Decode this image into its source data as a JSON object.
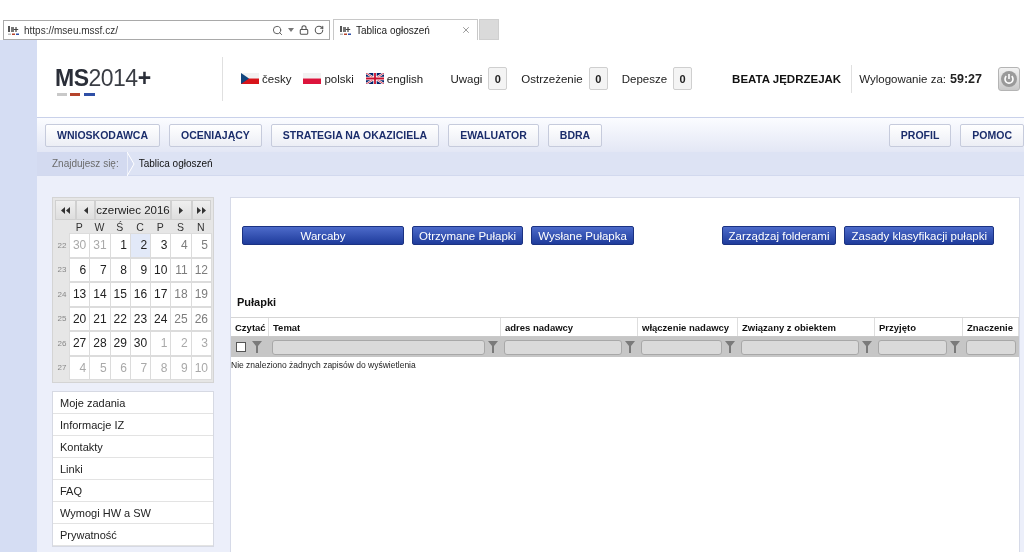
{
  "browser": {
    "url": "https://mseu.mssf.cz/",
    "tab_title": "Tablica ogłoszeń"
  },
  "header": {
    "logo": "**MS**2014**+**",
    "languages": [
      {
        "label": "česky",
        "kind": "cz"
      },
      {
        "label": "polski",
        "kind": "pl"
      },
      {
        "label": "english",
        "kind": "gb"
      }
    ],
    "counters": [
      {
        "label": "Uwagi",
        "value": "0"
      },
      {
        "label": "Ostrzeżenie",
        "value": "0"
      },
      {
        "label": "Depesze",
        "value": "0"
      }
    ],
    "user": "BEATA JĘDRZEJAK",
    "logout_label": "Wylogowanie za:",
    "logout_timer": "59:27"
  },
  "nav": {
    "left": [
      "WNIOSKODAWCA",
      "OCENIAJĄCY",
      "STRATEGIA NA OKAZICIELA",
      "EWALUATOR",
      "BDRA"
    ],
    "right": [
      "PROFIL",
      "POMOC"
    ]
  },
  "breadcrumb": {
    "label": "Znajdujesz się:",
    "current": "Tablica ogłoszeń"
  },
  "calendar": {
    "title": "czerwiec 2016",
    "weekdays": [
      "P",
      "W",
      "Ś",
      "C",
      "P",
      "S",
      "N"
    ],
    "weeks": [
      {
        "number": "22",
        "days": [
          {
            "day": "30",
            "other_month": true,
            "selected": false
          },
          {
            "day": "31",
            "other_month": true,
            "selected": false
          },
          {
            "day": "1",
            "other_month": false,
            "selected": false
          },
          {
            "day": "2",
            "other_month": false,
            "selected": true
          },
          {
            "day": "3",
            "other_month": false,
            "selected": false
          },
          {
            "day": "4",
            "other_month": false,
            "selected": false
          },
          {
            "day": "5",
            "other_month": false,
            "selected": false
          }
        ]
      },
      {
        "number": "23",
        "days": [
          {
            "day": "6",
            "other_month": false,
            "selected": false
          },
          {
            "day": "7",
            "other_month": false,
            "selected": false
          },
          {
            "day": "8",
            "other_month": false,
            "selected": false
          },
          {
            "day": "9",
            "other_month": false,
            "selected": false
          },
          {
            "day": "10",
            "other_month": false,
            "selected": false
          },
          {
            "day": "11",
            "other_month": false,
            "selected": false
          },
          {
            "day": "12",
            "other_month": false,
            "selected": false
          }
        ]
      },
      {
        "number": "24",
        "days": [
          {
            "day": "13",
            "other_month": false,
            "selected": false
          },
          {
            "day": "14",
            "other_month": false,
            "selected": false
          },
          {
            "day": "15",
            "other_month": false,
            "selected": false
          },
          {
            "day": "16",
            "other_month": false,
            "selected": false
          },
          {
            "day": "17",
            "other_month": false,
            "selected": false
          },
          {
            "day": "18",
            "other_month": false,
            "selected": false
          },
          {
            "day": "19",
            "other_month": false,
            "selected": false
          }
        ]
      },
      {
        "number": "25",
        "days": [
          {
            "day": "20",
            "other_month": false,
            "selected": false
          },
          {
            "day": "21",
            "other_month": false,
            "selected": false
          },
          {
            "day": "22",
            "other_month": false,
            "selected": false
          },
          {
            "day": "23",
            "other_month": false,
            "selected": false
          },
          {
            "day": "24",
            "other_month": false,
            "selected": false
          },
          {
            "day": "25",
            "other_month": false,
            "selected": false
          },
          {
            "day": "26",
            "other_month": false,
            "selected": false
          }
        ]
      },
      {
        "number": "26",
        "days": [
          {
            "day": "27",
            "other_month": false,
            "selected": false
          },
          {
            "day": "28",
            "other_month": false,
            "selected": false
          },
          {
            "day": "29",
            "other_month": false,
            "selected": false
          },
          {
            "day": "30",
            "other_month": false,
            "selected": false
          },
          {
            "day": "1",
            "other_month": true,
            "selected": false
          },
          {
            "day": "2",
            "other_month": true,
            "selected": false
          },
          {
            "day": "3",
            "other_month": true,
            "selected": false
          }
        ]
      },
      {
        "number": "27",
        "days": [
          {
            "day": "4",
            "other_month": true,
            "selected": false
          },
          {
            "day": "5",
            "other_month": true,
            "selected": false
          },
          {
            "day": "6",
            "other_month": true,
            "selected": false
          },
          {
            "day": "7",
            "other_month": true,
            "selected": false
          },
          {
            "day": "8",
            "other_month": true,
            "selected": false
          },
          {
            "day": "9",
            "other_month": true,
            "selected": false
          },
          {
            "day": "10",
            "other_month": true,
            "selected": false
          }
        ]
      }
    ]
  },
  "sidebar": {
    "items": [
      "Moje zadania",
      "Informacje IZ",
      "Kontakty",
      "Linki",
      "FAQ",
      "Wymogi HW a SW",
      "Prywatność"
    ]
  },
  "actions": {
    "left": [
      "Warcaby",
      "Otrzymane Pułapki",
      "Wysłane Pułapka"
    ],
    "right": [
      "Zarządzaj folderami",
      "Zasady klasyfikacji pułapki"
    ]
  },
  "table": {
    "title": "Pułapki",
    "columns": [
      {
        "label": "Czytać",
        "kind": "checkbox",
        "checked": false,
        "filter_button": true
      },
      {
        "label": "Temat",
        "kind": "text",
        "filter_button": true
      },
      {
        "label": "adres nadawcy",
        "kind": "text",
        "filter_button": true
      },
      {
        "label": "włączenie nadawcy",
        "kind": "text",
        "filter_button": true
      },
      {
        "label": "Związany z obiektem",
        "kind": "text",
        "filter_button": true
      },
      {
        "label": "Przyjęto",
        "kind": "text",
        "filter_button": true
      },
      {
        "label": "Znaczenie",
        "kind": "text",
        "filter_button": false
      }
    ],
    "empty_message": "Nie znaleziono żadnych zapisów do wyświetlenia"
  }
}
